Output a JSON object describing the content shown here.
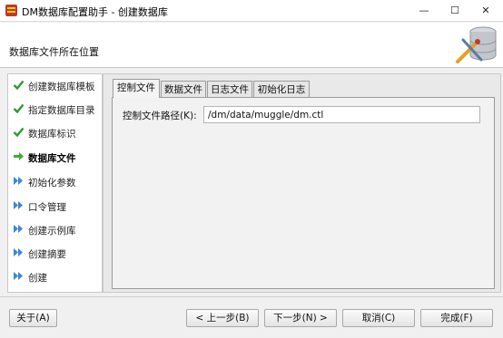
{
  "window": {
    "title": "DM数据库配置助手 - 创建数据库",
    "minimize": "—",
    "maximize": "☐",
    "close": "✕"
  },
  "header": {
    "title": "数据库文件所在位置"
  },
  "steps": [
    {
      "label": "创建数据库模板",
      "state": "done",
      "icon": "check-icon"
    },
    {
      "label": "指定数据库目录",
      "state": "done",
      "icon": "check-icon"
    },
    {
      "label": "数据库标识",
      "state": "done",
      "icon": "check-icon"
    },
    {
      "label": "数据库文件",
      "state": "current",
      "icon": "green-arrow-icon"
    },
    {
      "label": "初始化参数",
      "state": "pending",
      "icon": "blue-double-arrow-icon"
    },
    {
      "label": "口令管理",
      "state": "pending",
      "icon": "blue-double-arrow-icon"
    },
    {
      "label": "创建示例库",
      "state": "pending",
      "icon": "blue-double-arrow-icon"
    },
    {
      "label": "创建摘要",
      "state": "pending",
      "icon": "blue-double-arrow-icon"
    },
    {
      "label": "创建",
      "state": "pending",
      "icon": "blue-double-arrow-icon"
    }
  ],
  "tabs": [
    {
      "label": "控制文件",
      "active": true
    },
    {
      "label": "数据文件",
      "active": false
    },
    {
      "label": "日志文件",
      "active": false
    },
    {
      "label": "初始化日志",
      "active": false
    }
  ],
  "control_file": {
    "label": "控制文件路径(K):",
    "value": "/dm/data/muggle/dm.ctl"
  },
  "buttons": {
    "about": "关于(A)",
    "prev": "< 上一步(B)",
    "next": "下一步(N) >",
    "cancel": "取消(C)",
    "finish": "完成(F)"
  },
  "colors": {
    "check": "#2e9a2e",
    "arrow_current": "#3dab34",
    "arrow_pending": "#3a86d6"
  }
}
